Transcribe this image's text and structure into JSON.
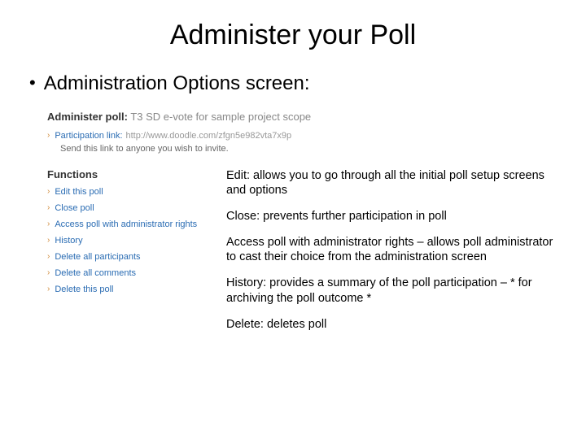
{
  "title": "Administer your Poll",
  "bullet": "•",
  "bullet_text": "Administration Options screen:",
  "admin": {
    "label": "Administer poll:",
    "poll_title": "T3 SD e-vote for sample project scope"
  },
  "participation": {
    "label": "Participation link:",
    "url": "http://www.doodle.com/zfgn5e982vta7x9p",
    "desc": "Send this link to anyone you wish to invite."
  },
  "functions": {
    "header": "Functions",
    "items": [
      "Edit this poll",
      "Close poll",
      "Access poll with administrator rights",
      "History",
      "Delete all participants",
      "Delete all comments",
      "Delete this poll"
    ]
  },
  "descriptions": [
    "Edit: allows you to go through all the initial poll setup screens and options",
    "Close: prevents further participation in poll",
    "Access poll with administrator rights – allows poll administrator to cast their choice from the administration screen",
    "History: provides a summary of the poll participation – * for archiving the poll outcome *",
    "Delete: deletes poll"
  ]
}
